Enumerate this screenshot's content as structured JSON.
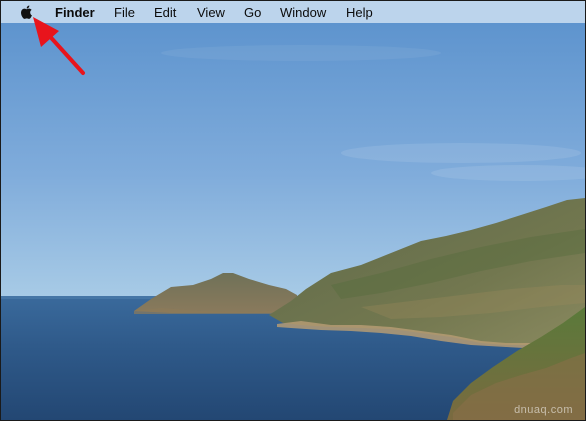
{
  "menubar": {
    "apple_menu": "apple-logo",
    "app_name": "Finder",
    "items": [
      "File",
      "Edit",
      "View",
      "Go",
      "Window",
      "Help"
    ]
  },
  "annotation": {
    "arrow_color": "#e8141c",
    "target": "apple-menu"
  },
  "watermark": "dnuaq.com",
  "colors": {
    "menubar": "#bcd4ec",
    "sky_top": "#5f95cf",
    "sky_bottom": "#9cc3e3",
    "sea": "#2e5788"
  }
}
